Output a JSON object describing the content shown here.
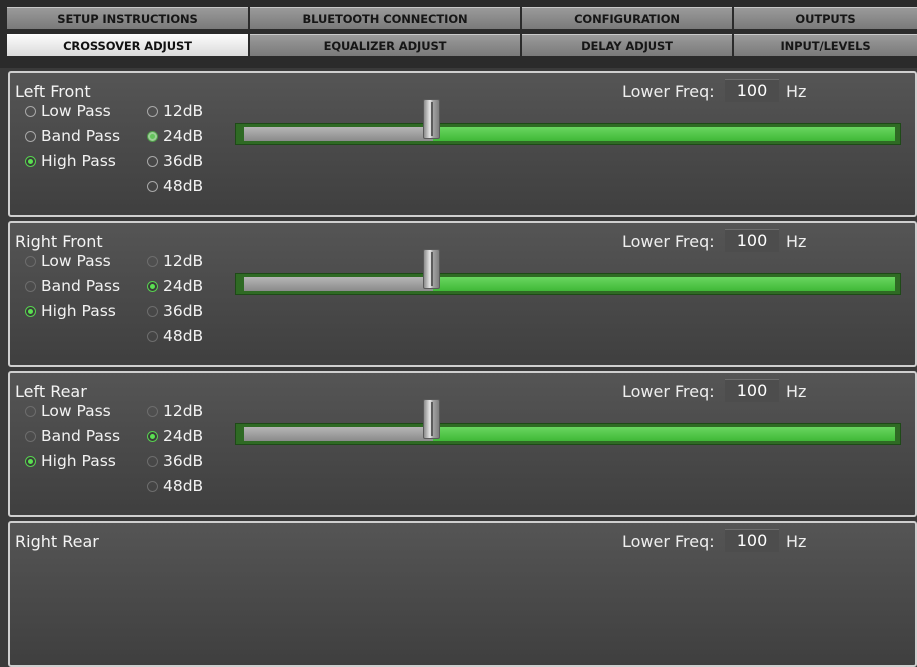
{
  "tabs": {
    "row1": [
      "SETUP INSTRUCTIONS",
      "BLUETOOTH CONNECTION",
      "CONFIGURATION",
      "OUTPUTS"
    ],
    "row2": [
      "CROSSOVER ADJUST",
      "EQUALIZER ADJUST",
      "DELAY ADJUST",
      "INPUT/LEVELS"
    ],
    "active": "CROSSOVER ADJUST"
  },
  "common": {
    "freq_label": "Lower Freq:",
    "freq_unit": "Hz",
    "filter_types": [
      "Low Pass",
      "Band Pass",
      "High Pass"
    ],
    "slopes": [
      "12dB",
      "24dB",
      "36dB",
      "48dB"
    ]
  },
  "channels": [
    {
      "name": "Left Front",
      "lower_freq": "100",
      "filter_type": "High Pass",
      "slope": "24dB",
      "slider_position": 0.29
    },
    {
      "name": "Right Front",
      "lower_freq": "100",
      "filter_type": "High Pass",
      "slope": "24dB",
      "slider_position": 0.29
    },
    {
      "name": "Left Rear",
      "lower_freq": "100",
      "filter_type": "High Pass",
      "slope": "24dB",
      "slider_position": 0.29
    },
    {
      "name": "Right Rear",
      "lower_freq": "100"
    }
  ],
  "colors": {
    "accent_green": "#4cc744",
    "tab_active": "#f0f0f0",
    "tab_inactive": "#8a8a8a",
    "background": "#3a3a3a"
  }
}
